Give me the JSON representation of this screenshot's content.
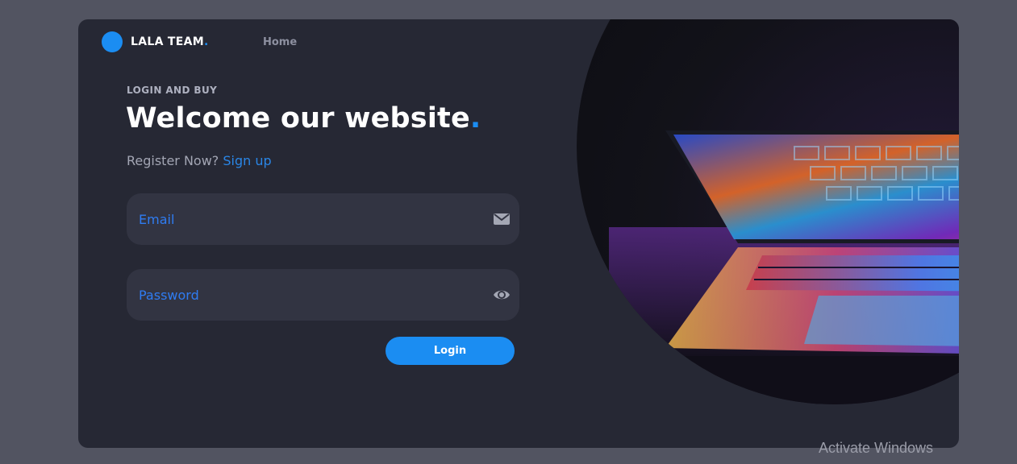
{
  "brand": {
    "name": "LALA TEAM",
    "dot": "."
  },
  "nav": {
    "home": "Home"
  },
  "hero": {
    "eyebrow": "LOGIN AND BUY",
    "title": "Welcome our website",
    "title_dot": ".",
    "register_prompt": "Register Now?",
    "signup_link": "Sign up"
  },
  "form": {
    "email": {
      "placeholder": "Email",
      "value": "",
      "icon": "envelope-icon"
    },
    "password": {
      "placeholder": "Password",
      "value": "",
      "icon": "eye-icon"
    },
    "login_label": "Login"
  },
  "overlay": {
    "watermark": "Activate Windows"
  },
  "colors": {
    "accent": "#1b8df2",
    "card": "#262834",
    "page": "#525461",
    "field": "#323442",
    "placeholder": "#2f7cf2"
  }
}
